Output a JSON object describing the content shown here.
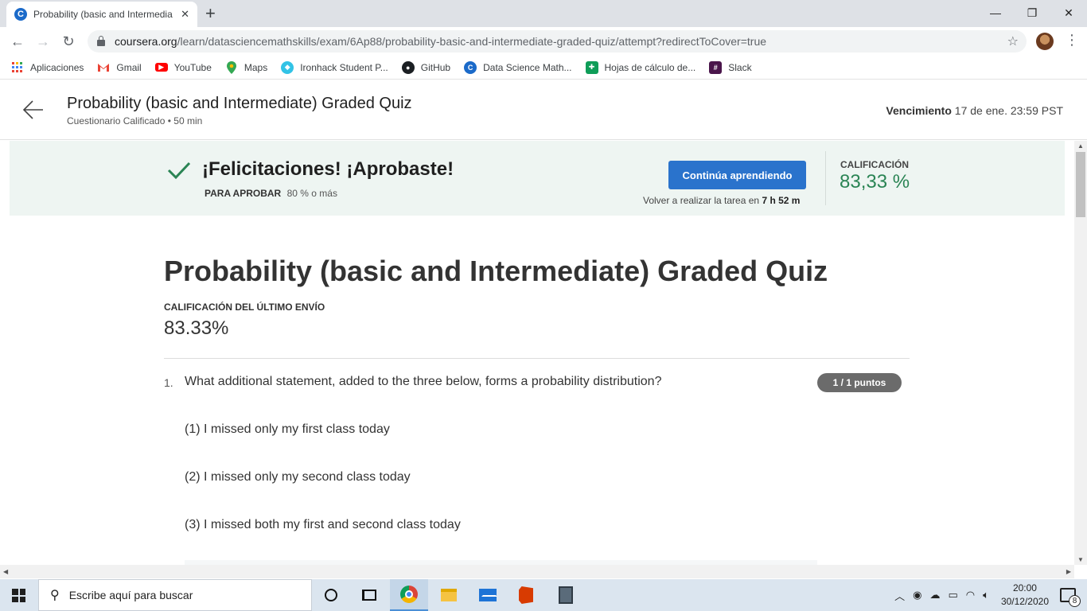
{
  "browser": {
    "tab_title": "Probability (basic and Intermedia",
    "tab_favicon": "C",
    "url_host": "coursera.org",
    "url_path": "/learn/datasciencemathskills/exam/6Ap88/probability-basic-and-intermediate-graded-quiz/attempt?redirectToCover=true"
  },
  "bookmarks": [
    {
      "label": "Aplicaciones",
      "icon": "apps-grid-icon"
    },
    {
      "label": "Gmail",
      "icon": "gmail-icon"
    },
    {
      "label": "YouTube",
      "icon": "youtube-icon"
    },
    {
      "label": "Maps",
      "icon": "maps-pin-icon"
    },
    {
      "label": "Ironhack Student P...",
      "icon": "ironhack-icon"
    },
    {
      "label": "GitHub",
      "icon": "github-icon"
    },
    {
      "label": "Data Science Math...",
      "icon": "coursera-icon"
    },
    {
      "label": "Hojas de cálculo de...",
      "icon": "sheets-icon"
    },
    {
      "label": "Slack",
      "icon": "slack-icon"
    }
  ],
  "header": {
    "title": "Probability (basic and Intermediate) Graded Quiz",
    "subtitle": "Cuestionario Calificado • 50 min",
    "due_label": "Vencimiento",
    "due_value": "17 de ene. 23:59 PST"
  },
  "banner": {
    "headline": "¡Felicitaciones! ¡Aprobaste!",
    "pass_label": "PARA APROBAR",
    "pass_value": "80 % o más",
    "continue_label": "Continúa aprendiendo",
    "retake_prefix": "Volver a realizar la tarea en",
    "retake_time": "7 h 52 m",
    "grade_label": "CALIFICACIÓN",
    "grade_value": "83,33 %"
  },
  "main": {
    "title": "Probability (basic and Intermediate) Graded Quiz",
    "last_label": "CALIFICACIÓN DEL ÚLTIMO ENVÍO",
    "last_value": "83.33%"
  },
  "question": {
    "number": "1.",
    "text": "What additional statement, added to the three below, forms a probability distribution?",
    "points": "1 / 1 puntos",
    "statements": [
      "(1) I missed only my first class today",
      "(2) I missed only my second class today",
      "(3) I missed both my first and second class today"
    ]
  },
  "taskbar": {
    "search_placeholder": "Escribe aquí para buscar",
    "time": "20:00",
    "date": "30/12/2020",
    "notification_count": "8"
  },
  "colors": {
    "accent_blue": "#2a73cc",
    "success_green": "#2a8454",
    "banner_bg": "#eef5f2"
  }
}
